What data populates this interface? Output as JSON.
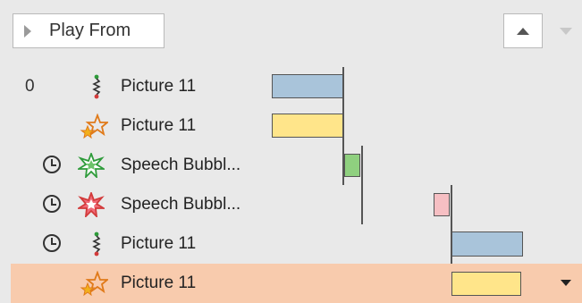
{
  "toolbar": {
    "play_from_label": "Play From"
  },
  "rows": [
    {
      "number": "0",
      "label": "Picture 11",
      "icon": "motion-path-icon",
      "has_clock": false,
      "bar_color": "#a9c4da"
    },
    {
      "number": "",
      "label": "Picture 11",
      "icon": "emphasis-star-icon",
      "has_clock": false,
      "bar_color": "#ffe58a"
    },
    {
      "number": "",
      "label": "Speech Bubbl...",
      "icon": "entrance-star-icon",
      "has_clock": true,
      "bar_color": "#8fd07f"
    },
    {
      "number": "",
      "label": "Speech Bubbl...",
      "icon": "exit-star-icon",
      "has_clock": true,
      "bar_color": "#f6bfc3"
    },
    {
      "number": "",
      "label": "Picture 11",
      "icon": "motion-path-icon",
      "has_clock": true,
      "bar_color": "#a9c4da"
    },
    {
      "number": "",
      "label": "Picture 11",
      "icon": "emphasis-star-icon",
      "has_clock": false,
      "bar_color": "#ffe58a",
      "selected": true
    }
  ],
  "colors": {
    "background": "#e9e9e9",
    "selected_row": "#f8cbad",
    "motion_bar": "#a9c4da",
    "emphasis_bar": "#ffe58a",
    "entrance_bar": "#8fd07f",
    "exit_bar": "#f6bfc3"
  }
}
